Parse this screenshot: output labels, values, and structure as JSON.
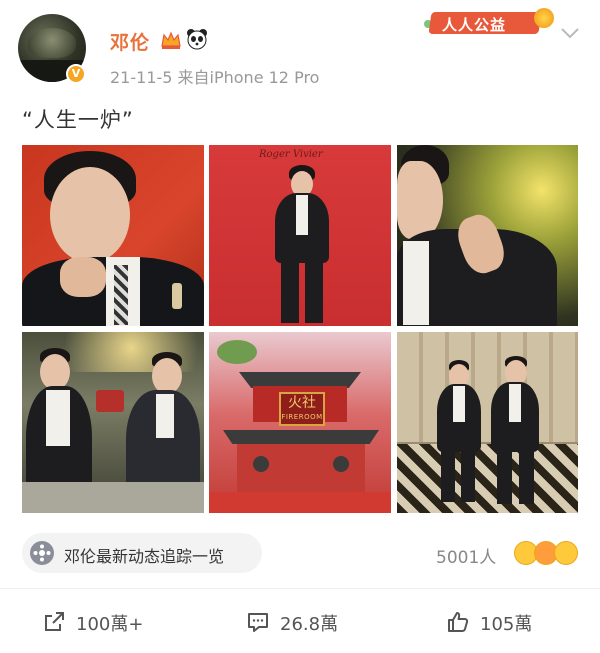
{
  "post": {
    "author": "邓伦",
    "meta": "21-11-5  来自iPhone 12 Pro",
    "text": "“人生一炉”",
    "charity_badge": "人人公益",
    "verified_badge": "V",
    "sign_cn": "火社",
    "sign_en": "FIREROOM",
    "photo2_script": "Roger Vivier"
  },
  "topic": {
    "label": "邓伦最新动态追踪一览",
    "count": "5001人"
  },
  "actions": {
    "share": "100萬+",
    "comment": "26.8萬",
    "like": "105萬"
  },
  "icons": {
    "share": "share-icon",
    "comment": "comment-icon",
    "like": "thumbs-up-icon",
    "more": "chevron-down-icon"
  },
  "colors": {
    "name": "#e8723a",
    "charity": "#e8583a",
    "meta": "#999999"
  }
}
